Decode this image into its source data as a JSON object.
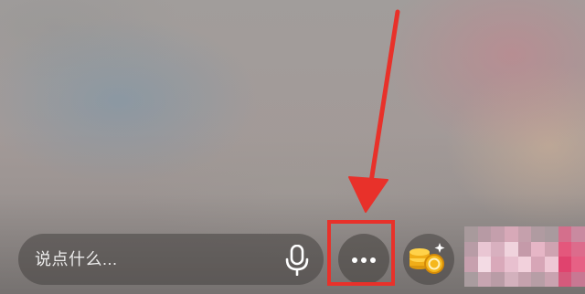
{
  "comment": {
    "placeholder": "说点什么..."
  },
  "icons": {
    "voice": "microphone-icon",
    "more": "more-dots-icon",
    "gift": "coin-stack-icon"
  },
  "annotation": {
    "color": "#e8312a",
    "target": "more-button"
  },
  "colors": {
    "pill_background": "rgba(70,66,64,0.55)",
    "coin_gold": "#f5b71c"
  }
}
